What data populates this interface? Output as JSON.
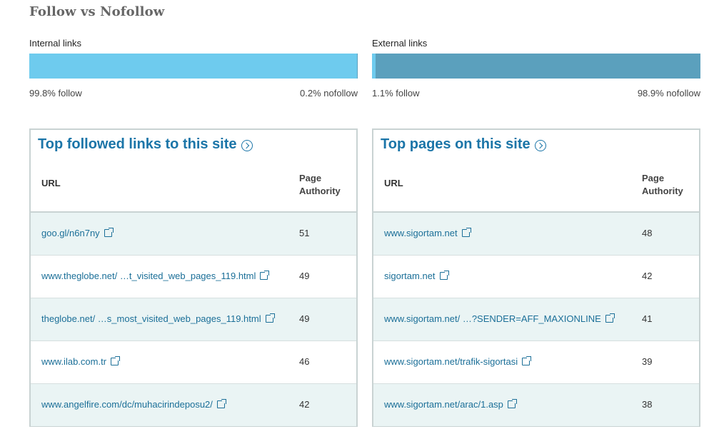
{
  "section": {
    "title": "Follow vs Nofollow"
  },
  "internal": {
    "label": "Internal links",
    "follow_pct": 99.8,
    "nofollow_pct": 0.2,
    "follow_label": "99.8% follow",
    "nofollow_label": "0.2% nofollow",
    "follow_color": "#6ecbee",
    "nofollow_color": "#5ba0bd"
  },
  "external": {
    "label": "External links",
    "follow_pct": 1.1,
    "nofollow_pct": 98.9,
    "follow_label": "1.1% follow",
    "nofollow_label": "98.9% nofollow",
    "follow_color": "#6ecbee",
    "nofollow_color": "#5ba0bd"
  },
  "panels": [
    {
      "title": "Top followed links to this site",
      "col_url": "URL",
      "col_pa": "Page Authority",
      "rows": [
        {
          "url": "goo.gl/n6n7ny",
          "pa": "51"
        },
        {
          "url": "www.theglobe.net/ …t_visited_web_pages_119.html",
          "pa": "49"
        },
        {
          "url": "theglobe.net/ …s_most_visited_web_pages_119.html",
          "pa": "49"
        },
        {
          "url": "www.ilab.com.tr",
          "pa": "46"
        },
        {
          "url": "www.angelfire.com/dc/muhacirindeposu2/",
          "pa": "42"
        }
      ]
    },
    {
      "title": "Top pages on this site",
      "col_url": "URL",
      "col_pa": "Page Authority",
      "rows": [
        {
          "url": "www.sigortam.net",
          "pa": "48"
        },
        {
          "url": "sigortam.net",
          "pa": "42"
        },
        {
          "url": "www.sigortam.net/ …?SENDER=AFF_MAXIONLINE",
          "pa": "41"
        },
        {
          "url": "www.sigortam.net/trafik-sigortasi",
          "pa": "39"
        },
        {
          "url": "www.sigortam.net/arac/1.asp",
          "pa": "38"
        }
      ]
    }
  ],
  "icons": {
    "help": "circle-chevron-right-icon",
    "external_link": "external-link-icon"
  },
  "colors": {
    "link": "#1b6f98",
    "title_link": "#1b75a8",
    "row_shade": "#eaf4f4",
    "border": "#c9d3d3"
  }
}
